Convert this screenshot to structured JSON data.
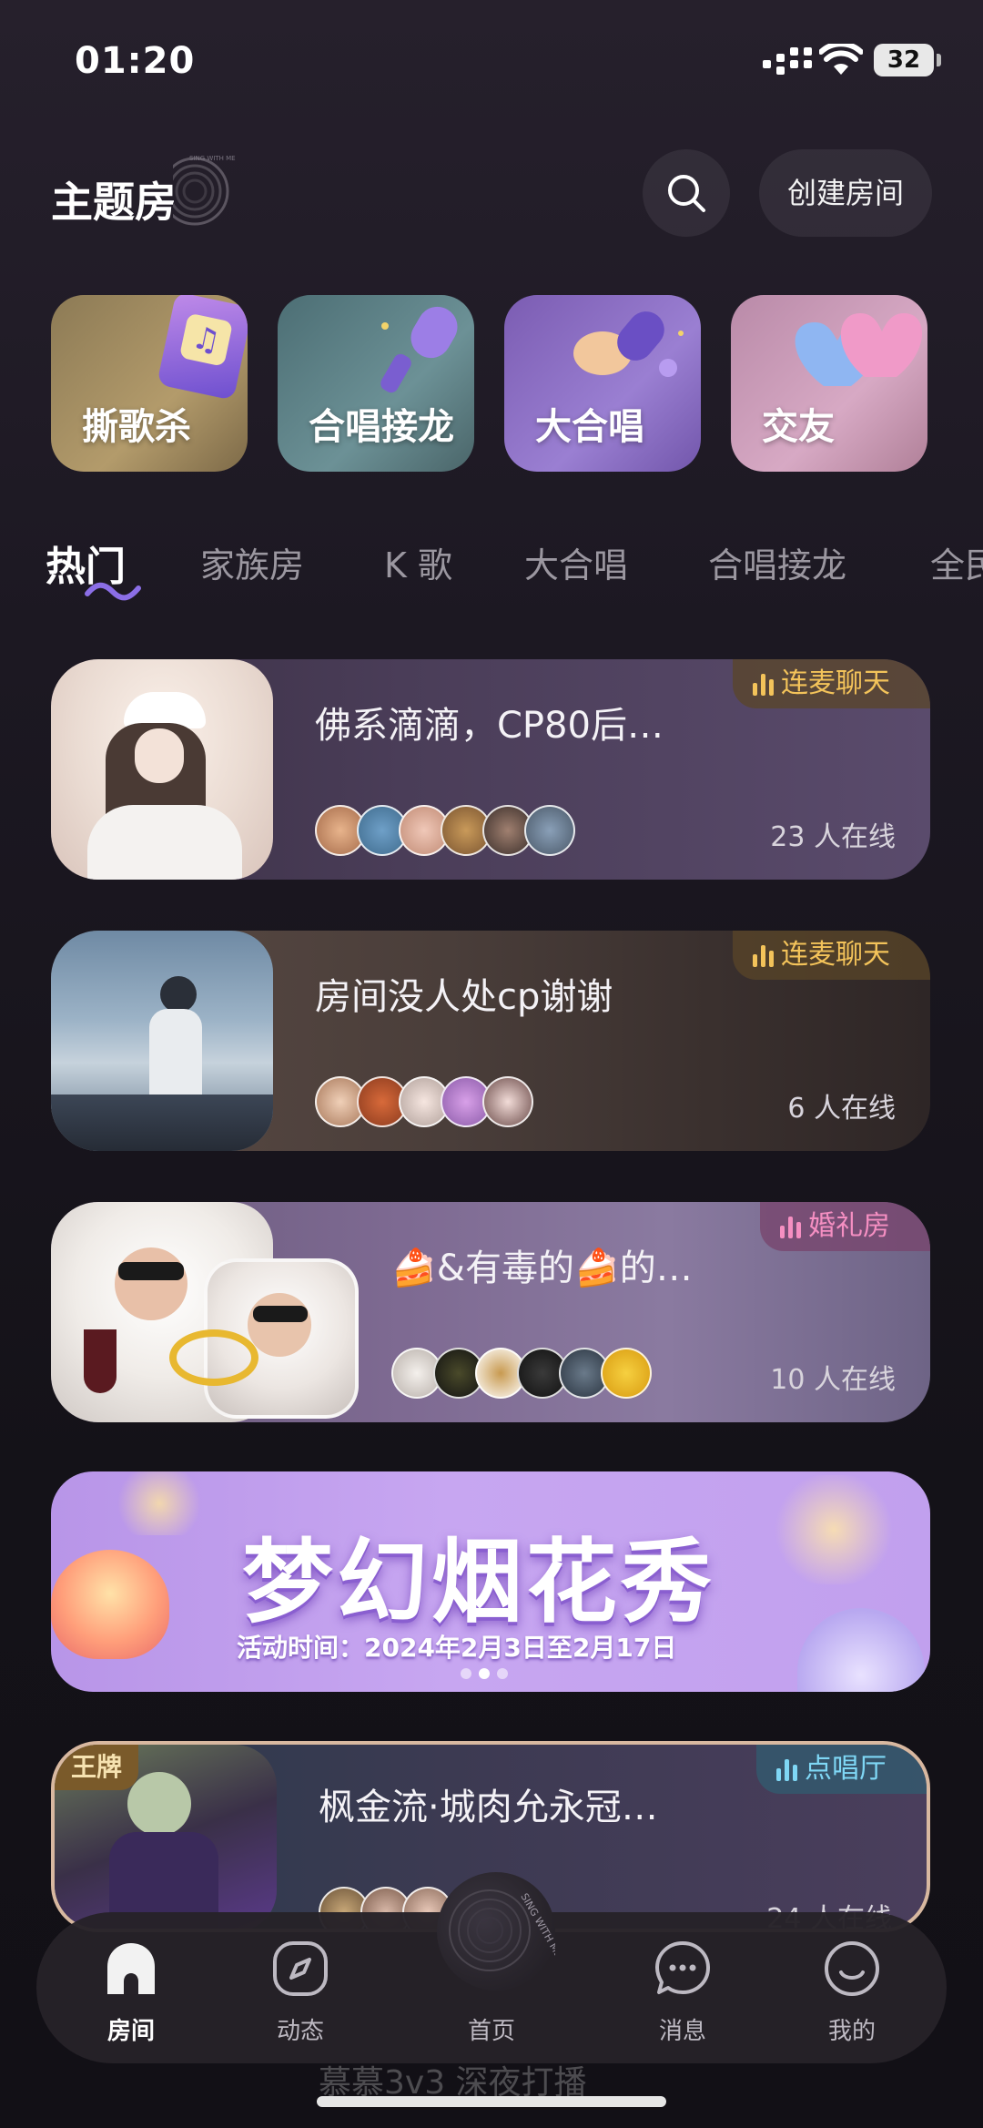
{
  "status_bar": {
    "time": "01:20",
    "battery": "32"
  },
  "header": {
    "title": "主题房",
    "logo_text": "SING WITH ME",
    "create_label": "创建房间"
  },
  "categories": [
    {
      "label": "撕歌杀",
      "color": "#a28a5d"
    },
    {
      "label": "合唱接龙",
      "color": "#5f8388"
    },
    {
      "label": "大合唱",
      "color": "#8a6ac0"
    },
    {
      "label": "交友",
      "color": "#c493b0"
    }
  ],
  "tabs": [
    "热门",
    "家族房",
    "K 歌",
    "大合唱",
    "合唱接龙",
    "全民"
  ],
  "rooms": [
    {
      "title": "佛系滴滴，CP80后…",
      "badge": "连麦聊天",
      "online": "23 人在线",
      "badge_color": "#f3c35a"
    },
    {
      "title": "房间没人处cp谢谢",
      "badge": "连麦聊天",
      "online": "6 人在线",
      "badge_color": "#f3c35a"
    },
    {
      "title": "🍰&有毒的🍰的…",
      "badge": "婚礼房",
      "online": "10 人在线",
      "badge_color": "#f58fc2"
    },
    {
      "title": "枫金流·城肉允永冠…",
      "badge": "点唱厅",
      "online": "24 人在线",
      "badge_color": "#7fd7f5",
      "corner_tag": "王牌"
    }
  ],
  "banner": {
    "title": "梦幻烟花秀",
    "subtitle": "活动时间：2024年2月3日至2月17日"
  },
  "behind_room_title": "慕慕3v3 深夜打播",
  "nav": [
    {
      "label": "房间",
      "icon": "home-icon"
    },
    {
      "label": "动态",
      "icon": "compass-icon"
    },
    {
      "label": "首页",
      "icon": "sing-disc-icon"
    },
    {
      "label": "消息",
      "icon": "chat-bubble-icon"
    },
    {
      "label": "我的",
      "icon": "smile-face-icon"
    }
  ],
  "center_disc_text": "SING WITH ME"
}
